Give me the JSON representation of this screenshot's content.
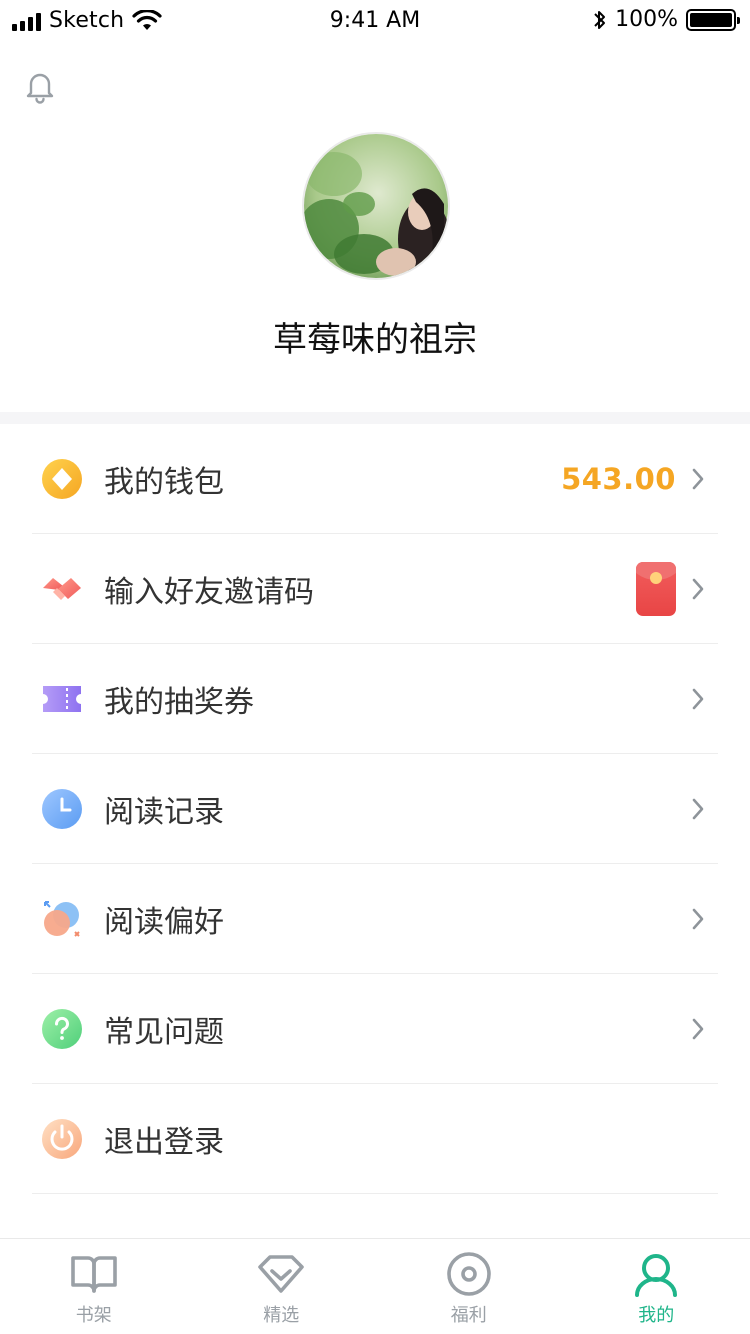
{
  "status_bar": {
    "carrier": "Sketch",
    "time": "9:41 AM",
    "battery_pct": "100%"
  },
  "profile": {
    "username": "草莓味的祖宗",
    "avatar_icon": "avatar-photo",
    "bell_icon": "bell-icon"
  },
  "menu": {
    "items": [
      {
        "label": "我的钱包",
        "value": "543.00",
        "icon": "wallet-coin-icon"
      },
      {
        "label": "输入好友邀请码",
        "icon": "handshake-icon"
      },
      {
        "label": "我的抽奖券",
        "icon": "ticket-icon"
      },
      {
        "label": "阅读记录",
        "icon": "clock-icon"
      },
      {
        "label": "阅读偏好",
        "icon": "preference-icon"
      },
      {
        "label": "常见问题",
        "icon": "question-icon"
      },
      {
        "label": "退出登录",
        "icon": "power-icon"
      }
    ]
  },
  "tabbar": {
    "tabs": [
      {
        "label": "书架",
        "icon": "book-icon"
      },
      {
        "label": "精选",
        "icon": "diamond-icon"
      },
      {
        "label": "福利",
        "icon": "target-icon"
      },
      {
        "label": "我的",
        "icon": "user-icon",
        "active": true
      }
    ]
  },
  "colors": {
    "accent": "#1fb58a",
    "wallet_value": "#f5a623",
    "text": "#333333"
  }
}
